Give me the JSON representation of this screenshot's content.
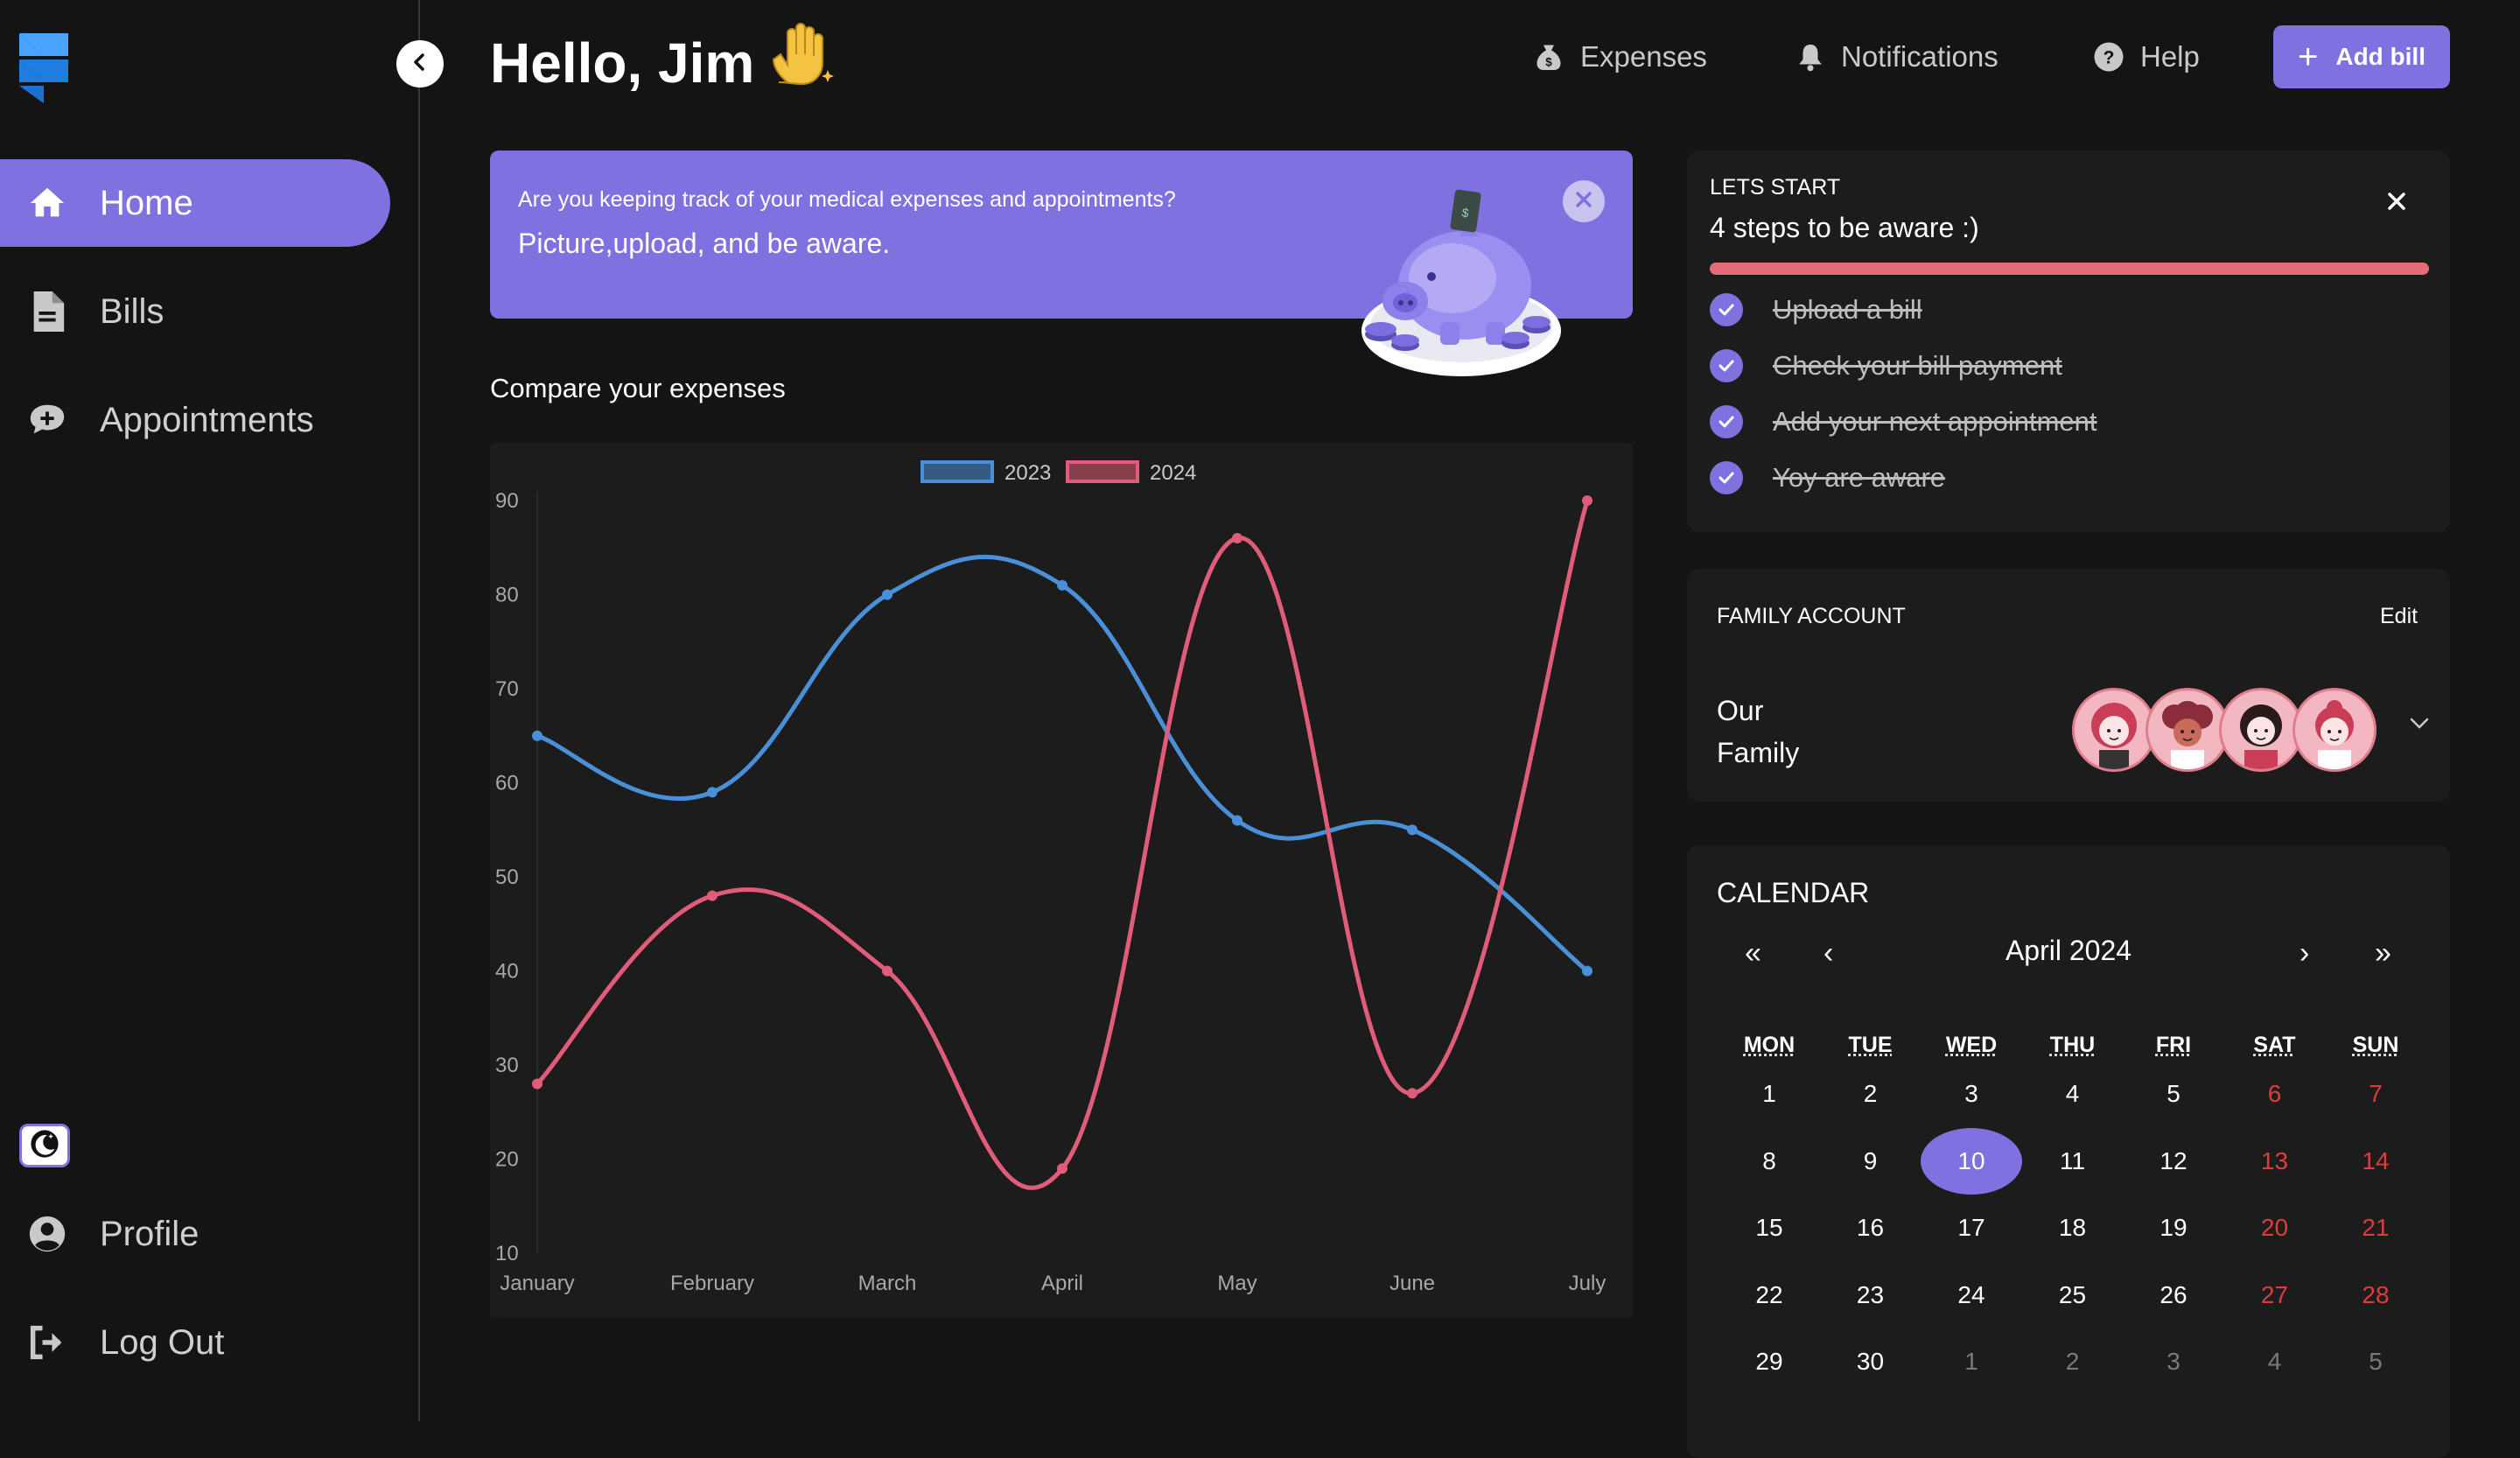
{
  "sidebar": {
    "items": [
      {
        "label": "Home",
        "icon": "home-icon",
        "active": true
      },
      {
        "label": "Bills",
        "icon": "file-icon",
        "active": false
      },
      {
        "label": "Appointments",
        "icon": "chat-plus-icon",
        "active": false
      }
    ],
    "bottom_items": [
      {
        "label": "Profile",
        "icon": "user-circle-icon"
      },
      {
        "label": "Log Out",
        "icon": "logout-icon"
      }
    ]
  },
  "header": {
    "greeting": "Hello, Jim",
    "wave": "👋",
    "links": [
      {
        "label": "Expenses",
        "icon": "money-bag-icon"
      },
      {
        "label": "Notifications",
        "icon": "bell-icon"
      },
      {
        "label": "Help",
        "icon": "help-icon"
      }
    ],
    "add_bill": "Add bill"
  },
  "banner": {
    "question": "Are you keeping track of your medical expenses and appointments?",
    "message": "Picture,upload, and be aware."
  },
  "compare_title": "Compare your expenses",
  "chart_data": {
    "type": "line",
    "categories": [
      "January",
      "February",
      "March",
      "April",
      "May",
      "June",
      "July"
    ],
    "series": [
      {
        "name": "2023",
        "values": [
          65,
          59,
          80,
          81,
          56,
          55,
          40
        ],
        "color": "#4a90d9"
      },
      {
        "name": "2024",
        "values": [
          28,
          48,
          40,
          19,
          86,
          27,
          90
        ],
        "color": "#e05c78"
      }
    ],
    "ylim": [
      10,
      90
    ],
    "yticks": [
      10,
      20,
      30,
      40,
      50,
      60,
      70,
      80,
      90
    ],
    "legend": "top-center",
    "grid": false
  },
  "steps": {
    "kicker": "LETS START",
    "title": "4 steps to be aware :)",
    "items": [
      "Upload a bill",
      "Check your bill payment",
      "Add your next appointment",
      "Yoy are aware"
    ],
    "progress": 1.0
  },
  "family": {
    "kicker": "FAMILY ACCOUNT",
    "edit": "Edit",
    "name": "Our Family"
  },
  "calendar": {
    "title": "CALENDAR",
    "month": "April 2024",
    "nav": {
      "first": "«",
      "prev": "‹",
      "next": "›",
      "last": "»"
    },
    "headers": [
      "MON",
      "TUE",
      "WED",
      "THU",
      "FRI",
      "SAT",
      "SUN"
    ],
    "weeks": [
      [
        "1",
        "2",
        "3",
        "4",
        "5",
        "6",
        "7"
      ],
      [
        "8",
        "9",
        "10",
        "11",
        "12",
        "13",
        "14"
      ],
      [
        "15",
        "16",
        "17",
        "18",
        "19",
        "20",
        "21"
      ],
      [
        "22",
        "23",
        "24",
        "25",
        "26",
        "27",
        "28"
      ],
      [
        "29",
        "30",
        "1",
        "2",
        "3",
        "4",
        "5"
      ]
    ],
    "today": "10",
    "colors": {
      "accent": "#8071e0",
      "weekend": "#e03b3b",
      "other": "#7a7a7a"
    }
  },
  "colors": {
    "accent": "#8071e0",
    "background": "#141414",
    "panel": "#1c1c1c"
  }
}
